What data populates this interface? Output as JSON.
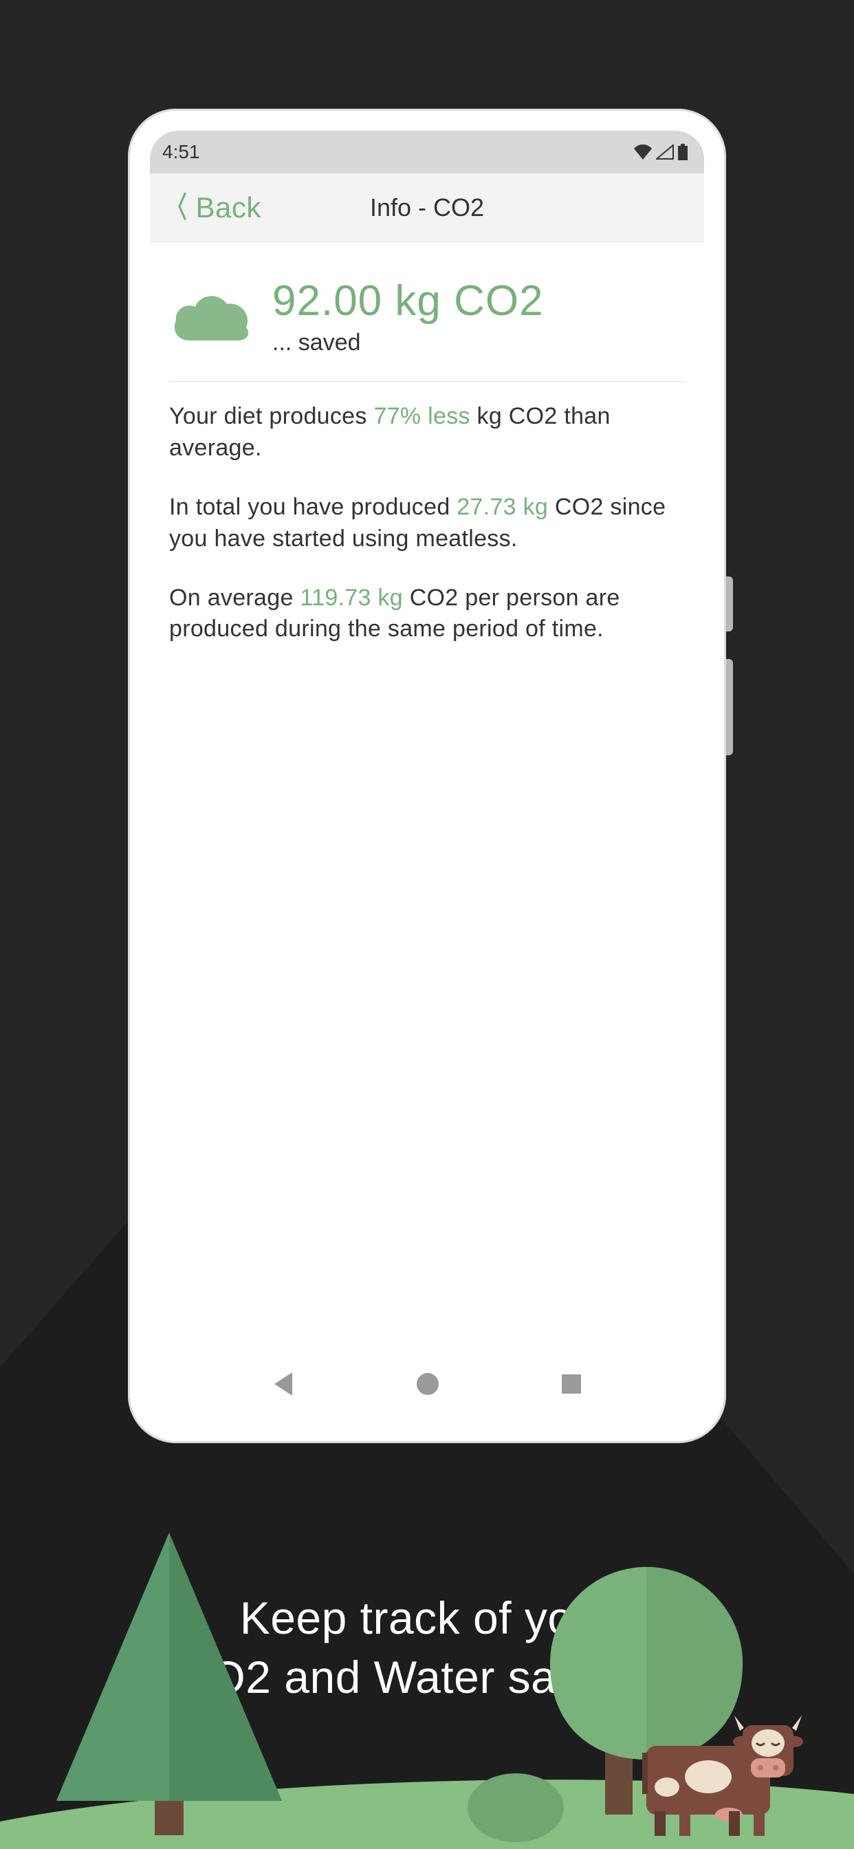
{
  "status": {
    "time": "4:51"
  },
  "nav": {
    "back_label": "Back",
    "title": "Info - CO2"
  },
  "hero": {
    "amount": "92.00 kg CO2",
    "subtitle": "... saved"
  },
  "paragraphs": {
    "p1_a": "Your diet produces ",
    "p1_highlight": "77% less",
    "p1_b": " kg CO2 than average.",
    "p2_a": "In total you have produced ",
    "p2_highlight": "27.73 kg",
    "p2_b": " CO2 since you have started using meatless.",
    "p3_a": "On average ",
    "p3_highlight": "119.73 kg",
    "p3_b": " CO2 per person are produced during the same period of time."
  },
  "caption": {
    "line1": "Keep track of your",
    "line2": "CO2 and Water savings!"
  }
}
